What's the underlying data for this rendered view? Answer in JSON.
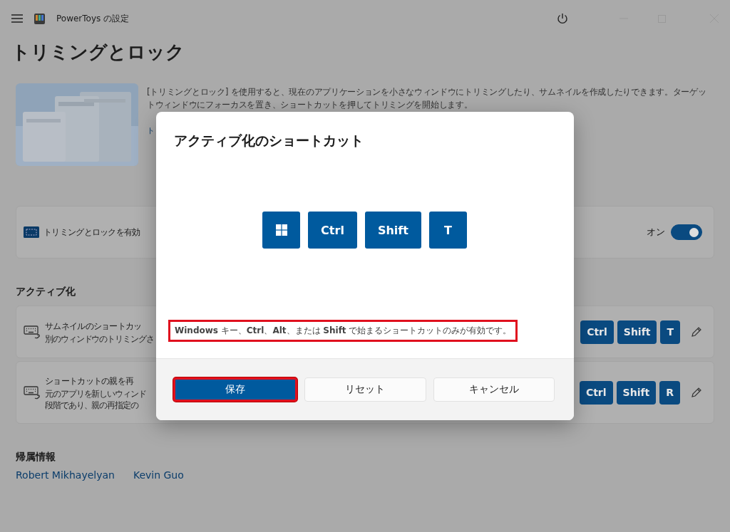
{
  "window": {
    "title": "PowerToys の設定"
  },
  "page": {
    "title": "トリミングとロック",
    "description": "[トリミングとロック] を使用すると、現在のアプリケーションを小さなウィンドウにトリミングしたり、サムネイルを作成したりできます。ターゲットウィンドウにフォーカスを置き、ショートカットを押してトリミングを開始します。",
    "link": "ト"
  },
  "enable": {
    "label": "トリミングとロックを有効",
    "state_label": "オン",
    "on": true
  },
  "activation": {
    "heading": "アクティブ化",
    "shortcuts": [
      {
        "title": "サムネイルのショートカッ",
        "description": [
          "別のウィンドウのトリミングさ"
        ],
        "keys": [
          "Ctrl",
          "Shift",
          "T"
        ]
      },
      {
        "title": "ショートカットの親を再",
        "description": [
          "元のアプリを新しいウィンド",
          "段階であり、親の再指定の"
        ],
        "keys": [
          "Ctrl",
          "Shift",
          "R"
        ]
      }
    ]
  },
  "attribution": {
    "heading": "帰属情報",
    "links": [
      "Robert Mikhayelyan",
      "Kevin Guo"
    ]
  },
  "dialog": {
    "title": "アクティブ化のショートカット",
    "keys": [
      {
        "kind": "windows"
      },
      {
        "kind": "text",
        "label": "Ctrl"
      },
      {
        "kind": "text",
        "label": "Shift"
      },
      {
        "kind": "text",
        "label": "T"
      }
    ],
    "note": {
      "text": "**Windows** キー、**Ctrl**、**Alt**、または **Shift** で始まるショートカットのみが有効です。",
      "highlighted": true
    },
    "buttons": [
      {
        "label": "保存",
        "kind": "primary",
        "highlighted": true
      },
      {
        "label": "リセット",
        "kind": "secondary",
        "highlighted": false
      },
      {
        "label": "キャンセル",
        "kind": "secondary",
        "highlighted": false
      }
    ]
  }
}
